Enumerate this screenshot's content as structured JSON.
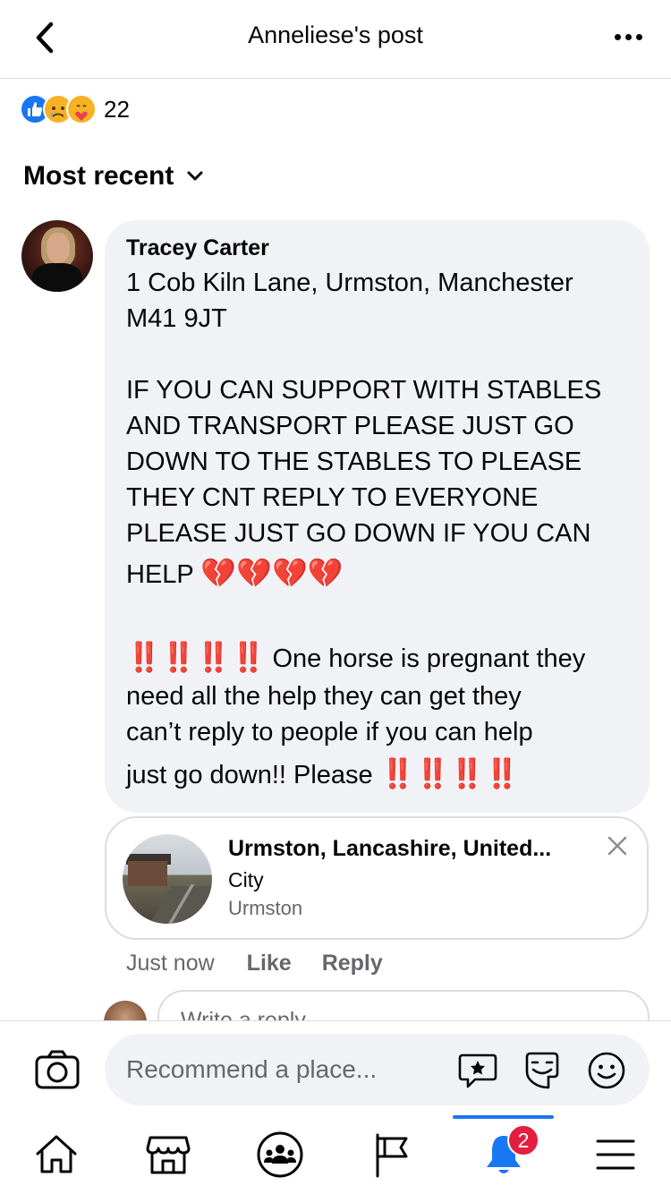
{
  "header": {
    "title": "Anneliese's post",
    "back_icon": "chevron-left-icon",
    "more_icon": "more-horizontal-icon"
  },
  "reactions": {
    "types": [
      "like-icon",
      "sad-icon",
      "care-icon"
    ],
    "count": "22"
  },
  "sort": {
    "label": "Most recent",
    "icon": "chevron-down-icon"
  },
  "comment": {
    "author": "Tracey Carter",
    "address_line1": "1 Cob Kiln Lane, Urmston, Manchester",
    "address_line2": "M41 9JT",
    "message_lines": [
      "IF YOU CAN SUPPORT WITH STABLES",
      "AND TRANSPORT PLEASE JUST GO",
      "DOWN TO THE STABLES TO PLEASE",
      "THEY CNT REPLY TO EVERYONE",
      "PLEASE JUST GO DOWN IF YOU CAN",
      "HELP"
    ],
    "hearts": "💔💔💔💔",
    "bangs_prefix": "‼️‼️‼️‼️",
    "note_line1": "One horse is pregnant they",
    "note_line2": "need all the help they can get they",
    "note_line3": "can’t reply to people if you can help",
    "note_line4": "just go down!! Please",
    "bangs_suffix": "‼️‼️‼️‼️",
    "time": "Just now",
    "like_label": "Like",
    "reply_label": "Reply"
  },
  "place": {
    "name": "Urmston, Lancashire, United...",
    "type": "City",
    "city": "Urmston",
    "close_icon": "close-icon"
  },
  "reply_box": {
    "placeholder": "Write a reply..."
  },
  "composer": {
    "placeholder": "Recommend a place...",
    "icons": [
      "camera-icon",
      "star-bubble-icon",
      "gif-sticker-icon",
      "smile-icon"
    ]
  },
  "bottom_nav": {
    "items": [
      "home-icon",
      "marketplace-icon",
      "groups-icon",
      "pages-flag-icon",
      "notifications-bell-icon",
      "menu-icon"
    ],
    "active_index": 4,
    "notification_badge": "2"
  },
  "colors": {
    "accent": "#1877f2",
    "bubble": "#f0f2f5",
    "secondary_text": "#65676b",
    "badge": "#e41e3f"
  }
}
